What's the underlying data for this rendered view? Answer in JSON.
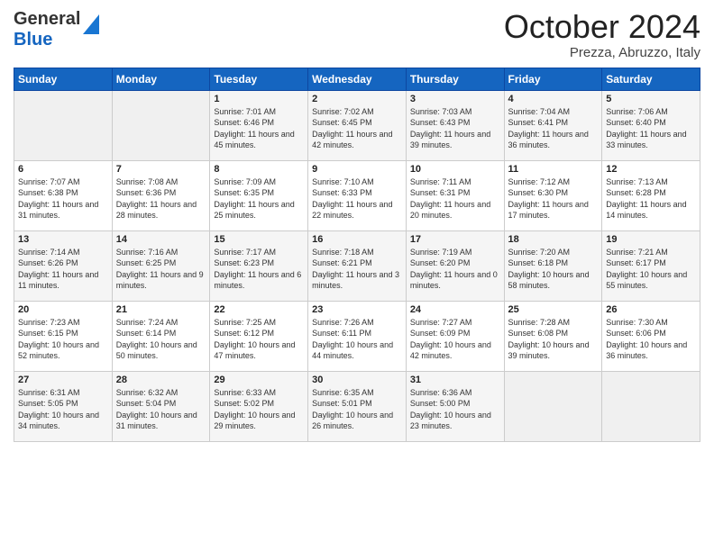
{
  "header": {
    "logo_general": "General",
    "logo_blue": "Blue",
    "month_title": "October 2024",
    "location": "Prezza, Abruzzo, Italy"
  },
  "weekdays": [
    "Sunday",
    "Monday",
    "Tuesday",
    "Wednesday",
    "Thursday",
    "Friday",
    "Saturday"
  ],
  "weeks": [
    [
      {
        "day": "",
        "details": ""
      },
      {
        "day": "",
        "details": ""
      },
      {
        "day": "1",
        "details": "Sunrise: 7:01 AM\nSunset: 6:46 PM\nDaylight: 11 hours and 45 minutes."
      },
      {
        "day": "2",
        "details": "Sunrise: 7:02 AM\nSunset: 6:45 PM\nDaylight: 11 hours and 42 minutes."
      },
      {
        "day": "3",
        "details": "Sunrise: 7:03 AM\nSunset: 6:43 PM\nDaylight: 11 hours and 39 minutes."
      },
      {
        "day": "4",
        "details": "Sunrise: 7:04 AM\nSunset: 6:41 PM\nDaylight: 11 hours and 36 minutes."
      },
      {
        "day": "5",
        "details": "Sunrise: 7:06 AM\nSunset: 6:40 PM\nDaylight: 11 hours and 33 minutes."
      }
    ],
    [
      {
        "day": "6",
        "details": "Sunrise: 7:07 AM\nSunset: 6:38 PM\nDaylight: 11 hours and 31 minutes."
      },
      {
        "day": "7",
        "details": "Sunrise: 7:08 AM\nSunset: 6:36 PM\nDaylight: 11 hours and 28 minutes."
      },
      {
        "day": "8",
        "details": "Sunrise: 7:09 AM\nSunset: 6:35 PM\nDaylight: 11 hours and 25 minutes."
      },
      {
        "day": "9",
        "details": "Sunrise: 7:10 AM\nSunset: 6:33 PM\nDaylight: 11 hours and 22 minutes."
      },
      {
        "day": "10",
        "details": "Sunrise: 7:11 AM\nSunset: 6:31 PM\nDaylight: 11 hours and 20 minutes."
      },
      {
        "day": "11",
        "details": "Sunrise: 7:12 AM\nSunset: 6:30 PM\nDaylight: 11 hours and 17 minutes."
      },
      {
        "day": "12",
        "details": "Sunrise: 7:13 AM\nSunset: 6:28 PM\nDaylight: 11 hours and 14 minutes."
      }
    ],
    [
      {
        "day": "13",
        "details": "Sunrise: 7:14 AM\nSunset: 6:26 PM\nDaylight: 11 hours and 11 minutes."
      },
      {
        "day": "14",
        "details": "Sunrise: 7:16 AM\nSunset: 6:25 PM\nDaylight: 11 hours and 9 minutes."
      },
      {
        "day": "15",
        "details": "Sunrise: 7:17 AM\nSunset: 6:23 PM\nDaylight: 11 hours and 6 minutes."
      },
      {
        "day": "16",
        "details": "Sunrise: 7:18 AM\nSunset: 6:21 PM\nDaylight: 11 hours and 3 minutes."
      },
      {
        "day": "17",
        "details": "Sunrise: 7:19 AM\nSunset: 6:20 PM\nDaylight: 11 hours and 0 minutes."
      },
      {
        "day": "18",
        "details": "Sunrise: 7:20 AM\nSunset: 6:18 PM\nDaylight: 10 hours and 58 minutes."
      },
      {
        "day": "19",
        "details": "Sunrise: 7:21 AM\nSunset: 6:17 PM\nDaylight: 10 hours and 55 minutes."
      }
    ],
    [
      {
        "day": "20",
        "details": "Sunrise: 7:23 AM\nSunset: 6:15 PM\nDaylight: 10 hours and 52 minutes."
      },
      {
        "day": "21",
        "details": "Sunrise: 7:24 AM\nSunset: 6:14 PM\nDaylight: 10 hours and 50 minutes."
      },
      {
        "day": "22",
        "details": "Sunrise: 7:25 AM\nSunset: 6:12 PM\nDaylight: 10 hours and 47 minutes."
      },
      {
        "day": "23",
        "details": "Sunrise: 7:26 AM\nSunset: 6:11 PM\nDaylight: 10 hours and 44 minutes."
      },
      {
        "day": "24",
        "details": "Sunrise: 7:27 AM\nSunset: 6:09 PM\nDaylight: 10 hours and 42 minutes."
      },
      {
        "day": "25",
        "details": "Sunrise: 7:28 AM\nSunset: 6:08 PM\nDaylight: 10 hours and 39 minutes."
      },
      {
        "day": "26",
        "details": "Sunrise: 7:30 AM\nSunset: 6:06 PM\nDaylight: 10 hours and 36 minutes."
      }
    ],
    [
      {
        "day": "27",
        "details": "Sunrise: 6:31 AM\nSunset: 5:05 PM\nDaylight: 10 hours and 34 minutes."
      },
      {
        "day": "28",
        "details": "Sunrise: 6:32 AM\nSunset: 5:04 PM\nDaylight: 10 hours and 31 minutes."
      },
      {
        "day": "29",
        "details": "Sunrise: 6:33 AM\nSunset: 5:02 PM\nDaylight: 10 hours and 29 minutes."
      },
      {
        "day": "30",
        "details": "Sunrise: 6:35 AM\nSunset: 5:01 PM\nDaylight: 10 hours and 26 minutes."
      },
      {
        "day": "31",
        "details": "Sunrise: 6:36 AM\nSunset: 5:00 PM\nDaylight: 10 hours and 23 minutes."
      },
      {
        "day": "",
        "details": ""
      },
      {
        "day": "",
        "details": ""
      }
    ]
  ]
}
